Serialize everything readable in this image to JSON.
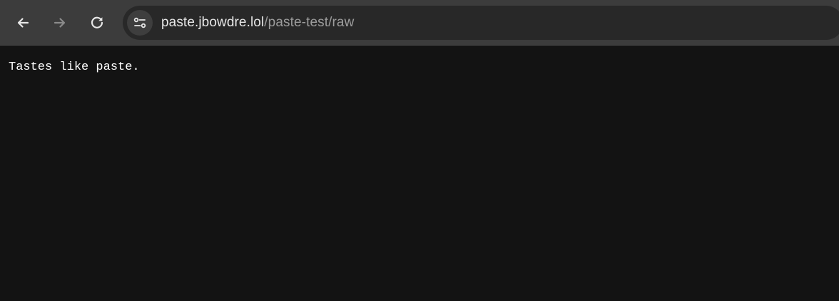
{
  "browser": {
    "nav": {
      "back_icon": "arrow-left-icon",
      "forward_icon": "arrow-right-icon",
      "reload_icon": "reload-icon",
      "forward_enabled": false
    },
    "address_bar": {
      "site_info_icon": "tune-icon",
      "url_host": "paste.jbowdre.lol",
      "url_path": "/paste-test/raw"
    }
  },
  "page": {
    "body_text": "Tastes like paste."
  },
  "colors": {
    "toolbar_bg": "#3c3c3c",
    "omnibox_bg": "#282828",
    "page_bg": "#131313",
    "text": "#ffffff",
    "url_path": "#9c9c9c"
  }
}
